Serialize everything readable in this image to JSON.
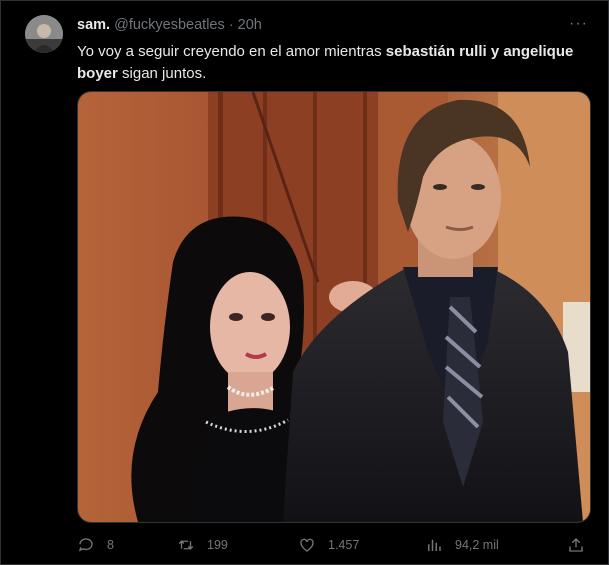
{
  "tweet": {
    "display_name": "sam.",
    "handle": "@fuckyesbeatles",
    "separator": "·",
    "time": "20h",
    "more_label": "···",
    "text_before": "Yo voy a seguir creyendo en el amor mientras ",
    "text_bold": "sebastián rulli y angelique boyer",
    "text_after": " sigan juntos."
  },
  "actions": {
    "replies": "8",
    "retweets": "199",
    "likes": "1.457",
    "views": "94,2 mil"
  },
  "icons": {
    "reply": "reply-icon",
    "retweet": "retweet-icon",
    "like": "heart-icon",
    "views": "views-icon",
    "share": "share-icon",
    "more": "more-icon"
  },
  "colors": {
    "background": "#000000",
    "text": "#e7e9ea",
    "muted": "#71767b",
    "border": "#2f3336"
  }
}
